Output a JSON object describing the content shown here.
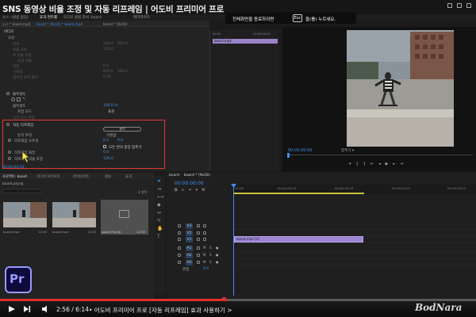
{
  "video_title": "SNS 동영상 비율 조정 및 자동 리프레임 | 어도비 프리미어 프로",
  "tooltip": {
    "text_before": "전체화면을 종료하려면",
    "key": "Esc",
    "text_after": "을(를) 누르세요."
  },
  "top_tabs": [
    "소스: (클립 없음)",
    "효과 컨트롤",
    "오디오 클립 믹서: board",
    "메타데이터"
  ],
  "source_tab": {
    "clip": "소스 * board.mp4",
    "sequence": "board * (9x16) * board.mp4",
    "sequence_tab": "board * (9x16)"
  },
  "effect_controls": {
    "header": "비디오",
    "rows": [
      {
        "label": "모션",
        "dim": false
      },
      {
        "label": "위치",
        "value": "540.0",
        "value2": "960.0",
        "dim": true
      },
      {
        "label": "비율 조정",
        "value": "100.0",
        "dim": true
      },
      {
        "label": "폭 비율 조정",
        "value": "",
        "dim": true
      },
      {
        "label": "균일 비율",
        "value": "",
        "dim": true
      },
      {
        "label": "회전",
        "value": "0.0",
        "dim": true
      },
      {
        "label": "기준점",
        "value": "960.0",
        "value2": "540.0",
        "dim": true
      },
      {
        "label": "깜박임 방지 필터",
        "value": "0.00",
        "dim": true
      }
    ],
    "opacity_section": "불투명도",
    "opacity_value": "100.0 %",
    "blend_label": "혼합 모드",
    "blend_value": "표준",
    "time_remap": "시간 다시 매핑",
    "reframe_section": "자동 리프레임",
    "reframe_analyze": "분석",
    "motion_tracking_label": "동작 추적",
    "motion_tracking_value": "기본값",
    "reframe_offset_label": "리프레임 오프셋",
    "reframe_offset_value": "0.0",
    "reframe_offset_value2": "0.0",
    "checkbox_label": "모든 면의 중앙 맞추기",
    "reframe_rotation_label": "리프레임 회전",
    "reframe_rotation_value": "0.0",
    "reframe_scale_label": "리프레임 비율 조정",
    "reframe_scale_value": "100.0",
    "timecode": "00:00:00:00"
  },
  "mini_timeline": {
    "ruler": [
      "00:00",
      "00:00:05:00"
    ],
    "clip_name": "board.mp4"
  },
  "program_monitor": {
    "timecode": "00:00:00:00",
    "fit": "맞추기"
  },
  "project": {
    "tabs": [
      "프로젝트: board",
      "미디어 브라우저",
      "라이브러리",
      "정보",
      "효과"
    ],
    "file": "board.prproj",
    "count": "3 항목",
    "items": [
      {
        "name": "board.mp4",
        "duration": "12:00"
      },
      {
        "name": "board.mp4",
        "duration": "12:00"
      },
      {
        "name": "board (9x16)",
        "duration": "12:00"
      }
    ]
  },
  "timeline": {
    "tab": "board",
    "tab2": "board * (9x16)",
    "timecode": "00:00:00:00",
    "ruler": [
      "00:00",
      "00:00:04:23",
      "00:00:09:23",
      "00:00:14:23",
      "00:00:19:23"
    ],
    "tracks": [
      {
        "name": "V3",
        "kind": "v"
      },
      {
        "name": "V2",
        "kind": "v"
      },
      {
        "name": "V1",
        "kind": "v"
      },
      {
        "name": "A1",
        "kind": "a"
      },
      {
        "name": "A2",
        "kind": "a"
      },
      {
        "name": "A3",
        "kind": "a"
      },
      {
        "name": "혼합",
        "kind": "m"
      }
    ],
    "clip": "board.mp4 [V]",
    "master_value": "0.0"
  },
  "player": {
    "time": "2:56 / 6:14",
    "chapter": "• 어도비 프리미어 프로 [자동 리프레임] 효과 사용하기 >",
    "progress_fraction": 0.47
  },
  "logo_text": "Pr",
  "watermark": "BodNara",
  "colors": {
    "accent_blue": "#3d8ff0",
    "highlight_red": "#e53935",
    "clip_purple": "#9d85d3",
    "progress_red": "#e52d2d"
  }
}
